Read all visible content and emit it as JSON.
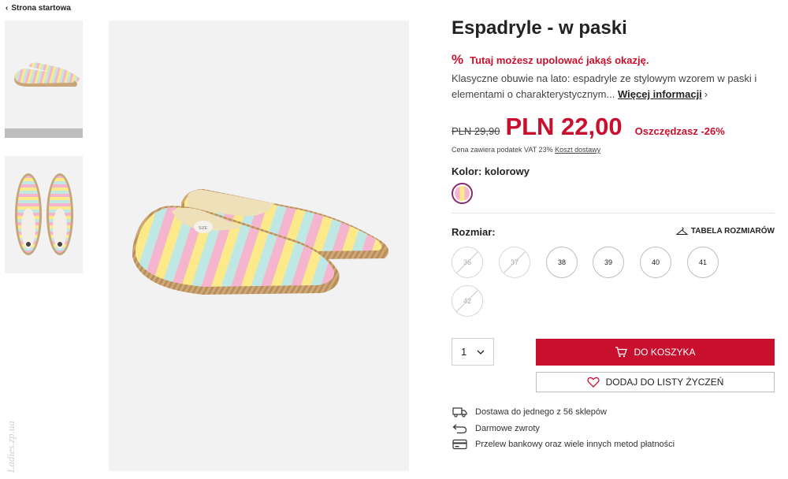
{
  "breadcrumb": {
    "label": "Strona startowa"
  },
  "product": {
    "title": "Espadryle - w paski",
    "promo_text": "Tutaj możesz upolować jakąś okazję.",
    "description": "Klasyczne obuwie na lato: espadryle ze stylowym wzorem w paski i elementami o charakterystycznym...",
    "more_label": "Więcej informacji",
    "old_price": "PLN 29,90",
    "price": "PLN 22,00",
    "saving": "Oszczędzasz -26%",
    "vat_text": "Cena zawiera podatek VAT 23%",
    "shipping_link": "Koszt dostawy",
    "color_label": "Kolor: kolorowy",
    "size_label": "Rozmiar:",
    "size_table_label": "TABELA ROZMIARÓW",
    "sizes": [
      {
        "label": "36",
        "available": false
      },
      {
        "label": "37",
        "available": false
      },
      {
        "label": "38",
        "available": true
      },
      {
        "label": "39",
        "available": true
      },
      {
        "label": "40",
        "available": true
      },
      {
        "label": "41",
        "available": true
      },
      {
        "label": "42",
        "available": false
      }
    ],
    "quantity": "1",
    "cart_label": "DO KOSZYKA",
    "wishlist_label": "DODAJ DO LISTY ŻYCZEŃ"
  },
  "perks": [
    {
      "icon": "truck-icon",
      "text": "Dostawa do jednego z 56 sklepów"
    },
    {
      "icon": "return-arrow-icon",
      "text": "Darmowe zwroty"
    },
    {
      "icon": "card-icon",
      "text": "Przelew bankowy oraz wiele innych metod płatności"
    }
  ],
  "watermark": "Ladies.zp.ua",
  "colors": {
    "accent": "#c8102e",
    "image_bg": "#f2f2f2",
    "stripe_pink": "#f6b5cf",
    "stripe_yellow": "#fbe98a",
    "stripe_mint": "#bfe8e4"
  }
}
